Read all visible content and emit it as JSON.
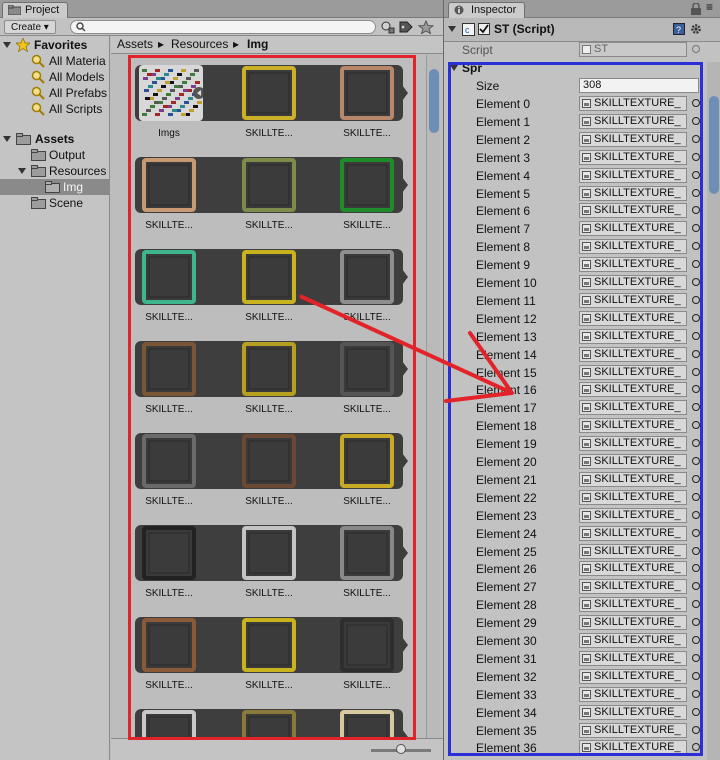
{
  "project": {
    "tab_label": "Project",
    "create_label": "Create",
    "search_placeholder": "",
    "favorites": {
      "label": "Favorites",
      "items": [
        "All Materia",
        "All Models",
        "All Prefabs",
        "All Scripts"
      ]
    },
    "assets": {
      "label": "Assets",
      "children": [
        "Output",
        "Resources",
        "Img",
        "Scene"
      ]
    },
    "breadcrumb": [
      "Assets",
      "Resources",
      "Img"
    ],
    "grid": {
      "first_caption": "Imgs",
      "item_caption": "SKILLTE...",
      "frame_colors": [
        [
          "atlas",
          "#cbb028",
          "#b8866a"
        ],
        [
          "#c79a73",
          "#7d8c4a",
          "#1e8c2a"
        ],
        [
          "#3fb58c",
          "#c8b21e",
          "#8e8e8e"
        ],
        [
          "#7a5636",
          "#b5a022",
          "#555555"
        ],
        [
          "#6a6a6a",
          "#6a4a34",
          "#c8aa26"
        ],
        [
          "#222222",
          "#c4c4c4",
          "#888888"
        ],
        [
          "#8a5a38",
          "#c8b21e",
          "#2e2e2e"
        ],
        [
          "#c8c8c8",
          "#8a7a3a",
          "#d8c8a0"
        ]
      ]
    }
  },
  "inspector": {
    "tab_label": "Inspector",
    "component_title": "ST (Script)",
    "script_label": "Script",
    "script_value": "ST",
    "array_label": "Spr",
    "size_label": "Size",
    "size_value": "308",
    "element_value": "SKILLTEXTURE_",
    "elements": [
      "Element 0",
      "Element 1",
      "Element 2",
      "Element 3",
      "Element 4",
      "Element 5",
      "Element 6",
      "Element 7",
      "Element 8",
      "Element 9",
      "Element 10",
      "Element 11",
      "Element 12",
      "Element 13",
      "Element 14",
      "Element 15",
      "Element 16",
      "Element 17",
      "Element 18",
      "Element 19",
      "Element 20",
      "Element 21",
      "Element 22",
      "Element 23",
      "Element 24",
      "Element 25",
      "Element 26",
      "Element 27",
      "Element 28",
      "Element 29",
      "Element 30",
      "Element 31",
      "Element 32",
      "Element 33",
      "Element 34",
      "Element 35",
      "Element 36"
    ]
  },
  "colors": {
    "annotation_red": "#e3232a",
    "annotation_blue": "#2b2fd8",
    "strip_bg": "#3e3e3e",
    "selection": "#8a8a8a"
  }
}
